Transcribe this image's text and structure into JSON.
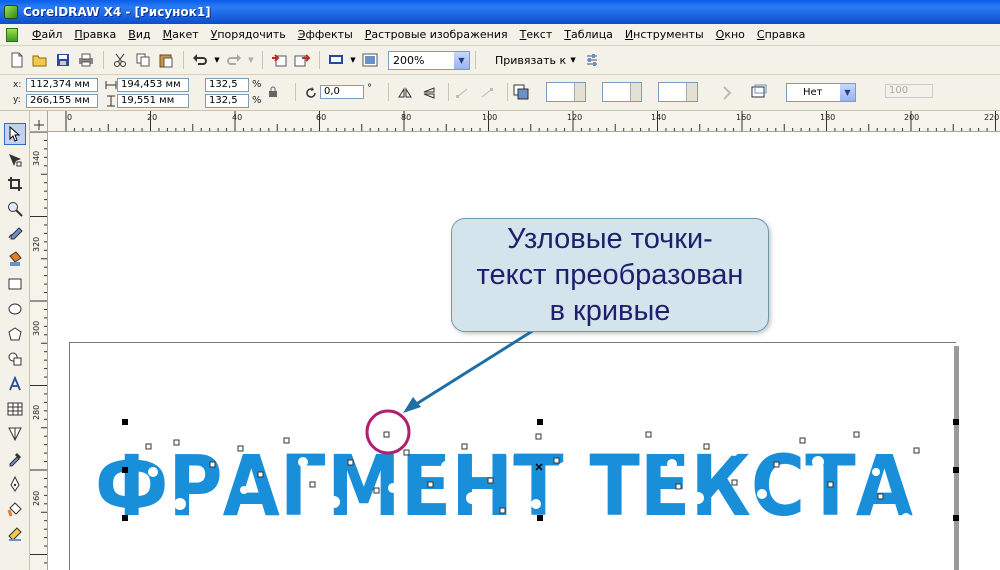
{
  "window": {
    "title": "CorelDRAW X4 - [Рисунок1]"
  },
  "menu": {
    "items": [
      "Файл",
      "Правка",
      "Вид",
      "Макет",
      "Упорядочить",
      "Эффекты",
      "Растровые изображения",
      "Текст",
      "Таблица",
      "Инструменты",
      "Окно",
      "Справка"
    ]
  },
  "toolbar": {
    "zoom": "200%",
    "snap_label": "Привязать к"
  },
  "propbar": {
    "x_label": "x:",
    "y_label": "y:",
    "x_value": "112,374 мм",
    "y_value": "266,155 мм",
    "width_value": "194,453 мм",
    "height_value": "19,551 мм",
    "scale_x": "132,5",
    "scale_y": "132,5",
    "percent": "%",
    "rotation": "0,0",
    "degree": "°",
    "wrap_value": "Нет",
    "disabled_value": "100"
  },
  "ruler": {
    "horizontal": [
      "0",
      "20",
      "40",
      "60",
      "80",
      "100",
      "120",
      "140",
      "160",
      "180",
      "200",
      "220"
    ],
    "vertical": [
      "340",
      "320",
      "300",
      "280",
      "260"
    ]
  },
  "canvas": {
    "artwork_text": "ФРАГМЕНТ ТЕКСТА",
    "artwork_color": "#1a8fd9",
    "callout_lines": [
      "Узловые точки-",
      "текст преобразован",
      "в кривые"
    ],
    "callout_fill": "#d4e4ec",
    "arrow_color": "#1e6fa6",
    "circle_color": "#b0206e"
  },
  "toolbox": {
    "tools": [
      "pick-tool-icon",
      "shape-tool-icon",
      "crop-tool-icon",
      "zoom-tool-icon",
      "freehand-tool-icon",
      "smart-fill-icon",
      "rectangle-tool-icon",
      "ellipse-tool-icon",
      "polygon-tool-icon",
      "basic-shapes-icon",
      "text-tool-icon",
      "table-tool-icon",
      "interactive-blend-icon",
      "eyedropper-icon",
      "outline-pen-icon",
      "fill-tool-icon",
      "interactive-fill-icon"
    ]
  }
}
